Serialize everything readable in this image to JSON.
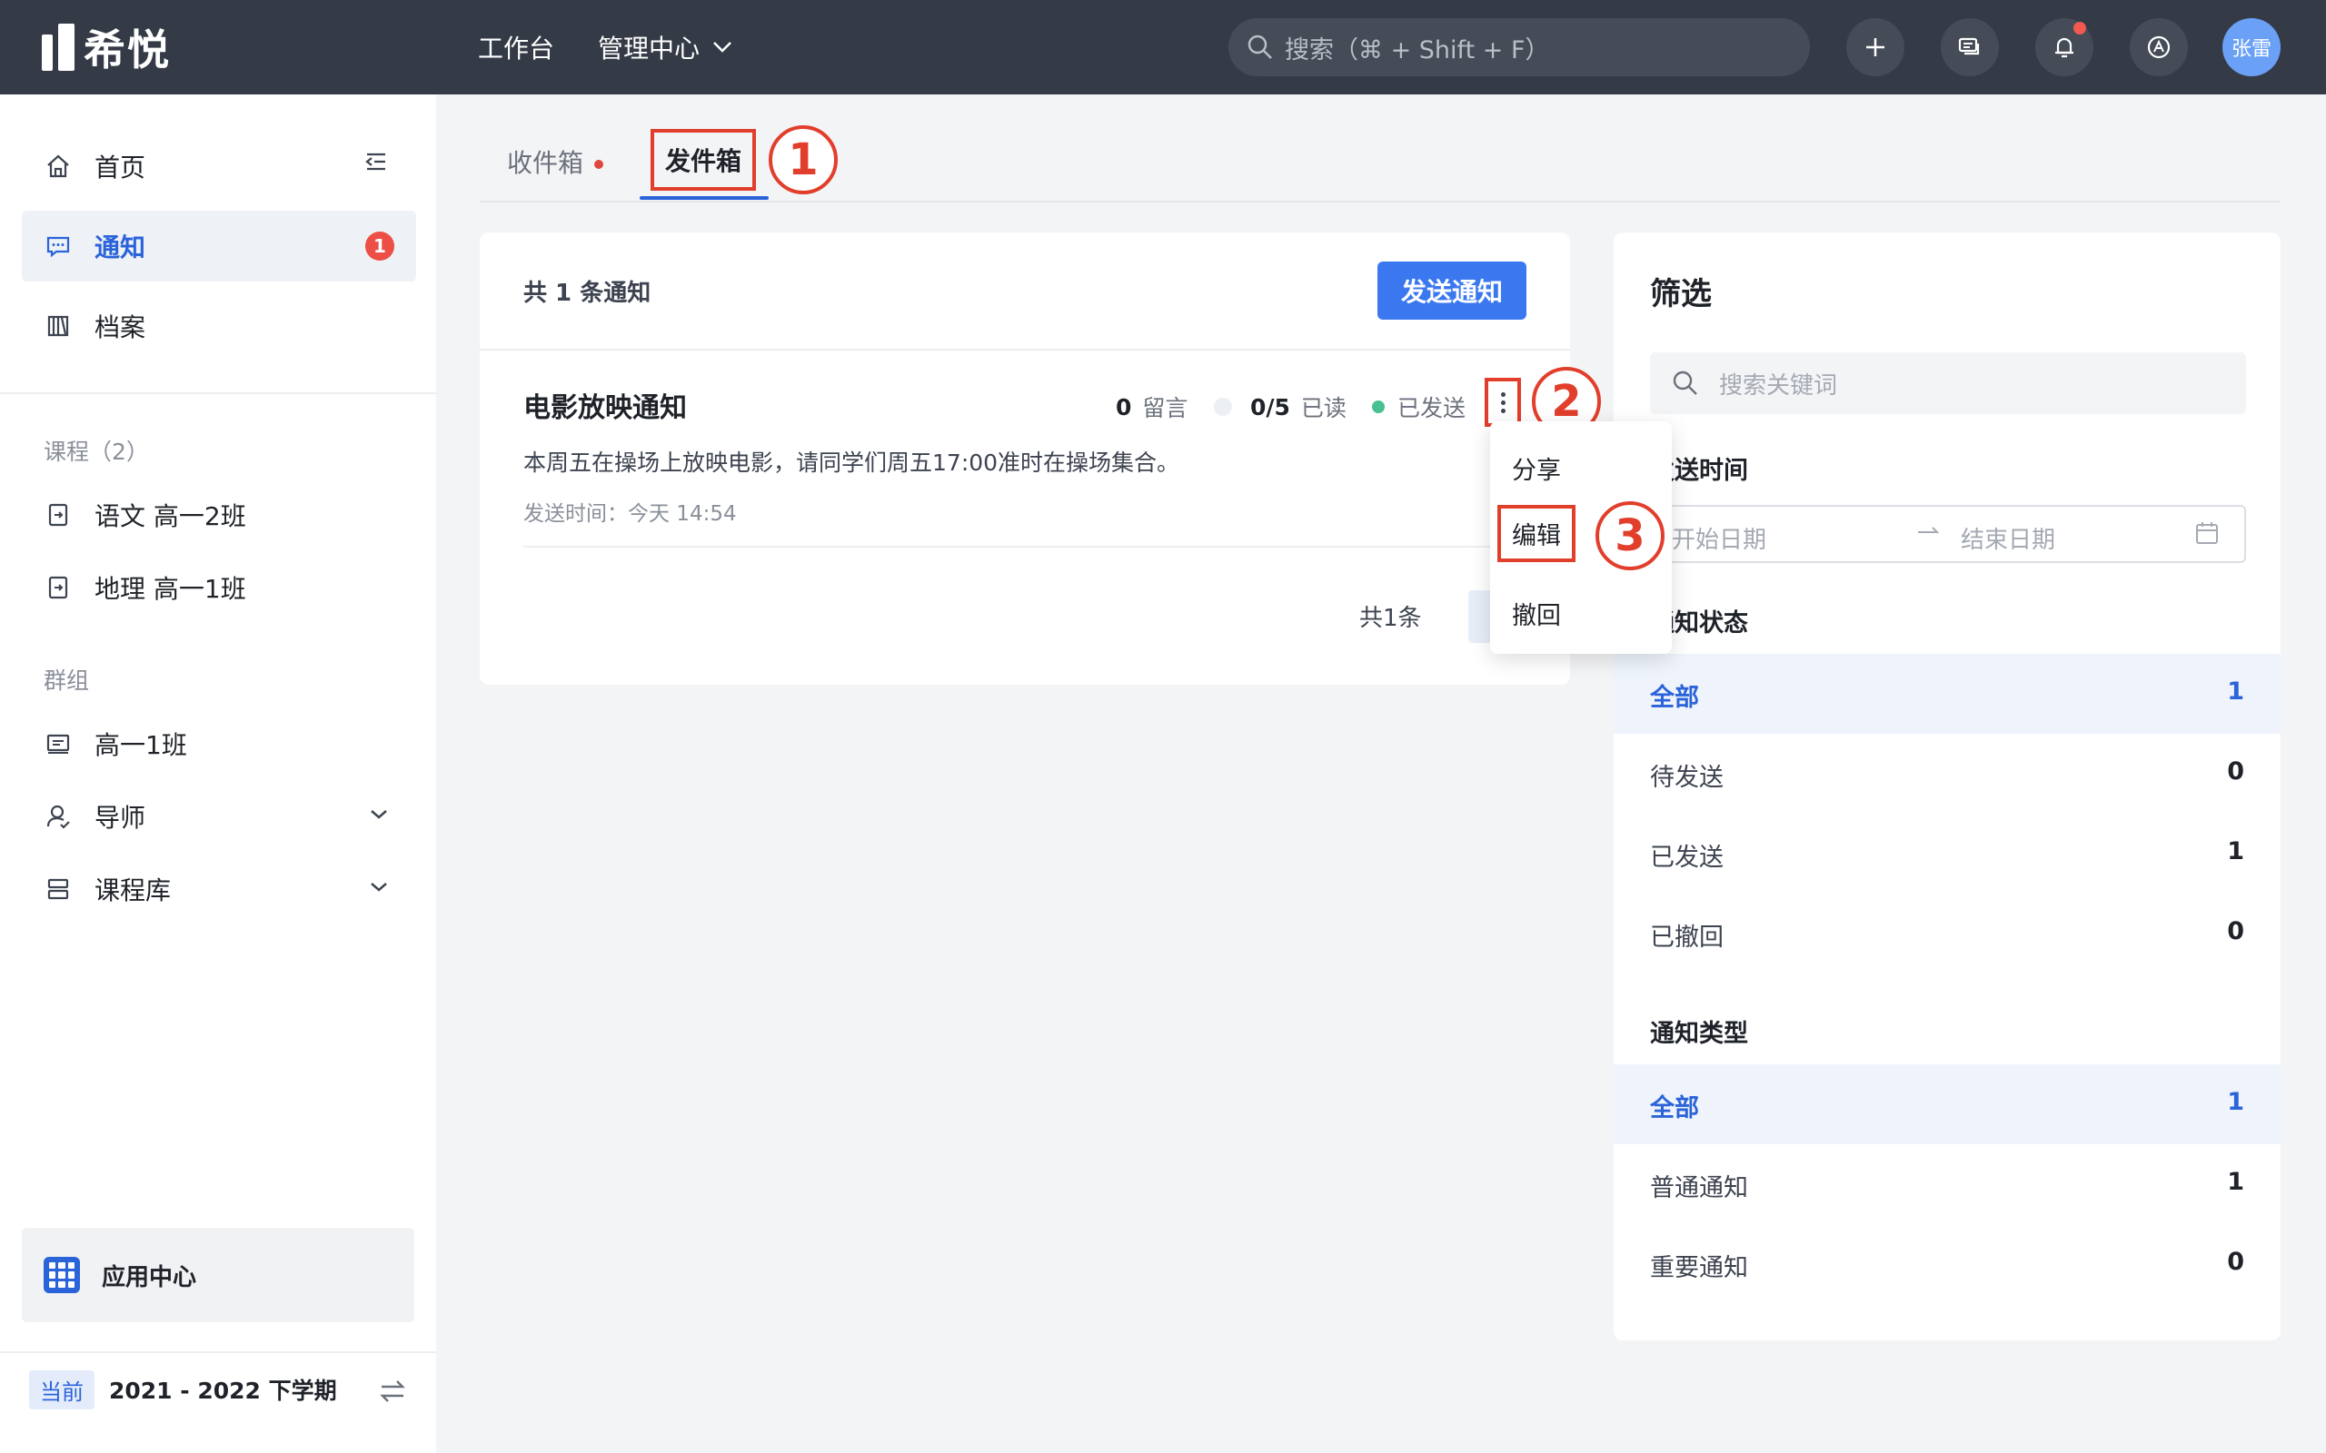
{
  "topbar": {
    "logo_text": "希悦",
    "nav_workbench": "工作台",
    "nav_admin": "管理中心",
    "search_placeholder": "搜索（⌘ + Shift + F）",
    "avatar_name": "张雷"
  },
  "sidebar": {
    "home": "首页",
    "notice": "通知",
    "notice_badge": "1",
    "archive": "档案",
    "courses_section": "课程（2）",
    "course_1": "语文 高一2班",
    "course_2": "地理 高一1班",
    "groups_section": "群组",
    "group_1": "高一1班",
    "mentor": "导师",
    "course_library": "课程库",
    "app_center": "应用中心",
    "term_tag": "当前",
    "term_name": "2021 - 2022 下学期"
  },
  "tabs": {
    "inbox": "收件箱",
    "outbox": "发件箱"
  },
  "annotations": {
    "step_1": "1",
    "step_2": "2",
    "step_3": "3"
  },
  "list": {
    "count_text": "共 1 条通知",
    "send_button": "发送通知",
    "total_text": "共1条"
  },
  "notice_item": {
    "title": "电影放映通知",
    "comments_count": "0",
    "comments_label": "留言",
    "read_count": "0/5",
    "read_label": "已读",
    "status": "已发送",
    "body": "本周五在操场上放映电影，请同学们周五17:00准时在操场集合。",
    "sent_time": "发送时间：今天 14:54"
  },
  "dropdown": {
    "share": "分享",
    "edit": "编辑",
    "revoke": "撤回"
  },
  "filter": {
    "title": "筛选",
    "search_placeholder": "搜索关键词",
    "send_time_label": "发送时间",
    "start_date": "开始日期",
    "end_date": "结束日期",
    "status_label": "通知状态",
    "status_options": [
      {
        "label": "全部",
        "count": "1"
      },
      {
        "label": "待发送",
        "count": "0"
      },
      {
        "label": "已发送",
        "count": "1"
      },
      {
        "label": "已撤回",
        "count": "0"
      }
    ],
    "type_label": "通知类型",
    "type_options": [
      {
        "label": "全部",
        "count": "1"
      },
      {
        "label": "普通通知",
        "count": "1"
      },
      {
        "label": "重要通知",
        "count": "0"
      }
    ]
  },
  "colors": {
    "topbar_bg": "#343a46",
    "accent_blue": "#2b63d9",
    "button_blue": "#3b78f0",
    "annotation_red": "#e23e2c",
    "status_green": "#48c08f"
  }
}
